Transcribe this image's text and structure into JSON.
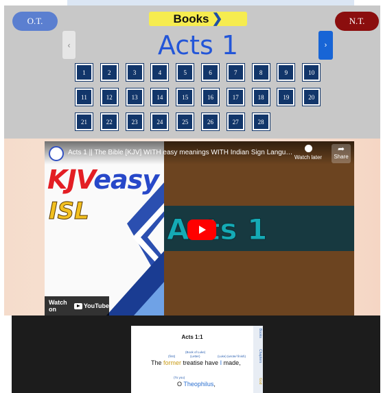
{
  "nav": {
    "ot_label": "O.T.",
    "nt_label": "N.T.",
    "books_label": "Books",
    "books_chevron": "❯",
    "prev_glyph": "‹",
    "next_glyph": "›",
    "chapter_title": "Acts 1"
  },
  "chapters": [
    "1",
    "2",
    "3",
    "4",
    "5",
    "6",
    "7",
    "8",
    "9",
    "10",
    "11",
    "12",
    "13",
    "14",
    "15",
    "16",
    "17",
    "18",
    "19",
    "20",
    "21",
    "22",
    "23",
    "24",
    "25",
    "26",
    "27",
    "28"
  ],
  "video": {
    "title": "Acts 1 || The Bible [KJV] WITH easy meanings WITH Indian Sign Languag...",
    "watch_later": "Watch later",
    "share": "Share",
    "brand_kjv": "KJV",
    "brand_easy": "easy",
    "brand_isl": "ISL",
    "big_title": "Acts 1",
    "watch_on": "Watch on",
    "youtube": "YouTube"
  },
  "verse": {
    "heading": "Acts 1:1",
    "gloss_book_of_luke": "(Book of Luke)",
    "gloss_first": "(first)",
    "gloss_letter": "(Letter)",
    "gloss_luke_wrote": "(Luke) (wrote/ finish)",
    "line1_pre": "The ",
    "line1_former": "former",
    "line1_mid": " treatise have ",
    "line1_i": "I",
    "line1_post": " made,",
    "gloss_to_you": "(To you)",
    "line2_pre": "O ",
    "line2_name": "Theophilus",
    "line2_post": ","
  },
  "side_tabs": {
    "books": "Books",
    "chapters": "Chapters",
    "god": "God"
  },
  "colors": {
    "ot": "#5b7fd0",
    "nt": "#8b0e0e",
    "books": "#f6ec4f",
    "chapter_title": "#2356d8",
    "chapter_btn": "#12366a",
    "next_btn": "#1865d6"
  }
}
